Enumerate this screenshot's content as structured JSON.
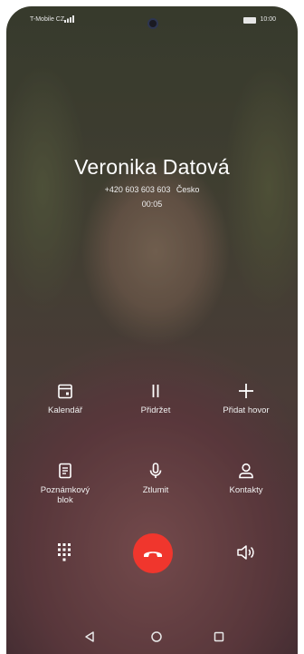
{
  "status_bar": {
    "carrier": "T-Mobile CZ",
    "time": "10:00"
  },
  "caller": {
    "name": "Veronika Datová",
    "number": "+420 603 603 603",
    "location": "Česko",
    "duration": "00:05"
  },
  "actions": {
    "calendar": "Kalendář",
    "hold": "Přidržet",
    "add_call": "Přidat hovor",
    "notepad": "Poznámkový\nblok",
    "mute": "Ztlumit",
    "contacts": "Kontakty"
  },
  "icons": {
    "calendar": "calendar-icon",
    "hold": "pause-icon",
    "add_call": "plus-icon",
    "notepad": "note-icon",
    "mute": "microphone-icon",
    "contacts": "person-icon",
    "dialpad": "dialpad-icon",
    "end_call": "phone-hangup-icon",
    "speaker": "speaker-icon",
    "back": "back-triangle-icon",
    "home": "home-circle-icon",
    "recents": "recents-square-icon"
  },
  "colors": {
    "end_call": "#f0362d",
    "text": "#ffffff"
  }
}
